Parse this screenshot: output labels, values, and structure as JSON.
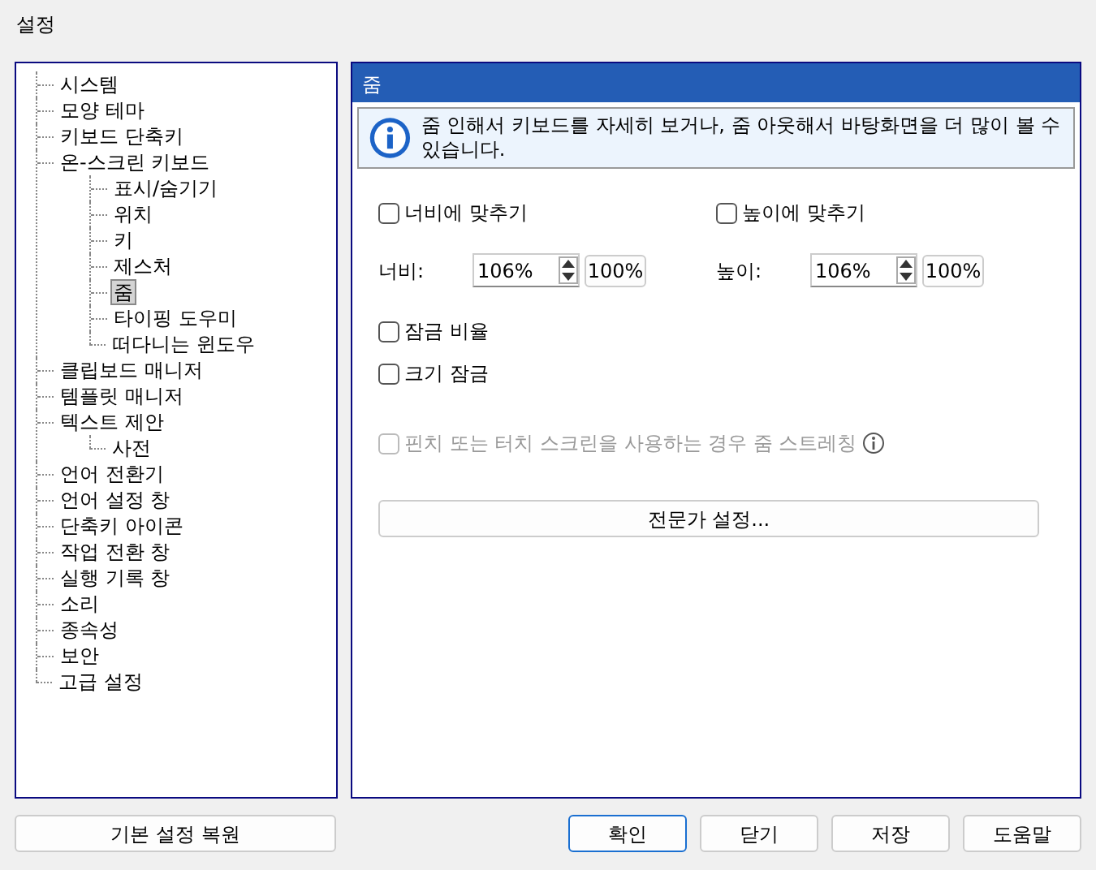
{
  "window": {
    "title": "설정"
  },
  "tree": [
    {
      "label": "시스템",
      "selected": false
    },
    {
      "label": "모양 테마",
      "selected": false
    },
    {
      "label": "키보드 단축키",
      "selected": false
    },
    {
      "label": "온-스크린 키보드",
      "selected": false,
      "children": [
        {
          "label": "표시/숨기기",
          "selected": false
        },
        {
          "label": "위치",
          "selected": false
        },
        {
          "label": "키",
          "selected": false
        },
        {
          "label": "제스처",
          "selected": false
        },
        {
          "label": "줌",
          "selected": true
        },
        {
          "label": "타이핑 도우미",
          "selected": false
        },
        {
          "label": "떠다니는 윈도우",
          "selected": false
        }
      ]
    },
    {
      "label": "클립보드 매니저",
      "selected": false
    },
    {
      "label": "템플릿 매니저",
      "selected": false
    },
    {
      "label": "텍스트 제안",
      "selected": false,
      "children": [
        {
          "label": "사전",
          "selected": false
        }
      ]
    },
    {
      "label": "언어 전환기",
      "selected": false
    },
    {
      "label": "언어 설정 창",
      "selected": false
    },
    {
      "label": "단축키 아이콘",
      "selected": false
    },
    {
      "label": "작업 전환 창",
      "selected": false
    },
    {
      "label": "실행 기록 창",
      "selected": false
    },
    {
      "label": "소리",
      "selected": false
    },
    {
      "label": "종속성",
      "selected": false
    },
    {
      "label": "보안",
      "selected": false
    },
    {
      "label": "고급 설정",
      "selected": false
    }
  ],
  "panel": {
    "title": "줌",
    "info": "줌 인해서 키보드를 자세히 보거나, 줌 아웃해서 바탕화면을 더 많이 볼 수 있습니다.",
    "fit_options": [
      {
        "label": "너비에 맞추기",
        "checked": false
      },
      {
        "label": "높이에 맞추기",
        "checked": false
      }
    ],
    "sizes": [
      {
        "label": "너비:",
        "value": "106%",
        "reset": "100%"
      },
      {
        "label": "높이:",
        "value": "106%",
        "reset": "100%"
      }
    ],
    "lock_options": [
      {
        "label": "잠금 비율",
        "checked": false
      },
      {
        "label": "크기 잠금",
        "checked": false
      }
    ],
    "pinch": {
      "label": "핀치 또는 터치 스크린을 사용하는 경우 줌 스트레칭",
      "checked": false,
      "disabled": true
    },
    "expert_button": "전문가 설정..."
  },
  "footer": {
    "restore_button": "기본 설정 복원",
    "buttons": [
      {
        "label": "확인",
        "default": true
      },
      {
        "label": "닫기",
        "default": false
      },
      {
        "label": "저장",
        "default": false
      },
      {
        "label": "도움말",
        "default": false
      }
    ]
  }
}
